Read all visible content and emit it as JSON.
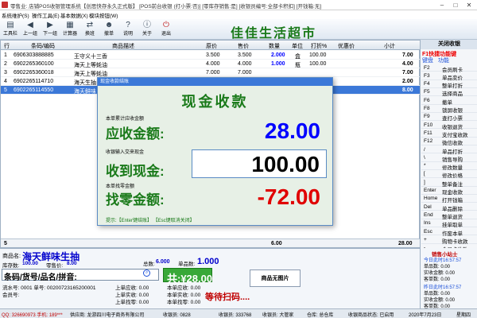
{
  "window": {
    "title": "零售业: 店铺POS收银管理系统【创思快存永久正式版】 [POS前台收银 (打小票:否)] [零库存销售:是] [收银员编号:全部卡积扣] [开钱箱:无]"
  },
  "menu": [
    "系统维护(S)",
    "操作工具(E)",
    "基本数据(X)",
    "模块按钮(W)"
  ],
  "toolbar": {
    "banner": "佳佳生活超市",
    "buttons": [
      "工具栏",
      "上一组",
      "下一组",
      "计算器",
      "换班",
      "撤单",
      "说明",
      "关于",
      "退出"
    ]
  },
  "grid": {
    "headers": [
      "行",
      "条码/编码",
      "商品描述",
      "原价",
      "售价",
      "数量",
      "单位",
      "打折%",
      "优惠价",
      "小计"
    ],
    "rows": [
      {
        "no": "1",
        "code": "6906303888885",
        "name": "王守义十三香",
        "orig": "3.500",
        "price": "3.500",
        "qty": "2.000",
        "unit": "盒",
        "disc": "100.00",
        "sub": "7.00"
      },
      {
        "no": "2",
        "code": "6902265360100",
        "name": "海天上等蚝油",
        "orig": "4.000",
        "price": "4.000",
        "qty": "1.000",
        "unit": "瓶",
        "disc": "100.00",
        "sub": "4.00"
      },
      {
        "no": "3",
        "code": "6902265360018",
        "name": "海天上等蚝油",
        "orig": "7.000",
        "price": "7.000",
        "qty": "",
        "unit": "",
        "disc": "",
        "sub": "7.00"
      },
      {
        "no": "4",
        "code": "6902265114710",
        "name": "海天生抽",
        "orig": "",
        "price": "",
        "qty": "",
        "unit": "",
        "disc": "",
        "sub": "2.00"
      },
      {
        "no": "5",
        "code": "6902265114550",
        "name": "海天鲜味",
        "orig": "",
        "price": "",
        "qty": "",
        "unit": "",
        "disc": "",
        "sub": "8.00"
      }
    ],
    "footer": {
      "count": "5",
      "qty": "6.00",
      "total": "28.00"
    }
  },
  "rpanel": {
    "title": "关闭收银",
    "hotkey": "F1快捷功能键",
    "tabs": [
      "键盘",
      "功能"
    ],
    "keys": [
      [
        "F2",
        "会员刷卡"
      ],
      [
        "F3",
        "单品变价"
      ],
      [
        "F4",
        "整单打折"
      ],
      [
        "F5",
        "选择商品"
      ],
      [
        "F6",
        "撤单"
      ],
      [
        "F8",
        "锁屏收银"
      ],
      [
        "F9",
        "查打小票"
      ],
      [
        "F10",
        "收银退货"
      ],
      [
        "F11",
        "支付宝收款"
      ],
      [
        "F12",
        "微信收款"
      ],
      [
        "/",
        "单品打折"
      ],
      [
        "\\",
        "销售导购"
      ],
      [
        "*",
        "修改数量"
      ],
      [
        "[",
        "修改价格"
      ],
      [
        "]",
        "整单备注"
      ],
      [
        "Enter",
        "现金收款"
      ],
      [
        "Home",
        "打开钱箱"
      ],
      [
        "Del",
        "单品删除"
      ],
      [
        "End",
        "整单退货"
      ],
      [
        "Ins",
        "挂单取单"
      ],
      [
        "Esc",
        "作废本单"
      ],
      [
        "+",
        "购物卡收款"
      ],
      [
        "-",
        "会员卡收款"
      ]
    ]
  },
  "dialog": {
    "title": "现金收款结账",
    "heading": "现金收款",
    "recv_small": "本单累计应收金额",
    "recv_label": "应收金额:",
    "recv_value": "28.00",
    "paid_small": "收银输入交来现金",
    "paid_label": "收到现金:",
    "paid_value": "100.00",
    "change_small": "本单找零金额",
    "change_label": "找零金额:",
    "change_value": "-72.00",
    "hint": "提示:【Enter键结账】 【Esc键取消关闭】"
  },
  "bottom": {
    "product_label": "商品名:",
    "product_name": "海天鲜味生抽",
    "stock_label": "库存数:",
    "stock_value": "100.00",
    "discount_label": "零售价:",
    "discount_value": "8.00",
    "qty_label": "总数:",
    "qty_value": "6.000",
    "price_label": "单品数:",
    "price_value": "1.000",
    "input_hint": "条码/货号/品名/拼音:",
    "flow_label": "流水号: 0001 单号: 00200723165200001",
    "member_label": "会员号:",
    "last_recv": "上单应收: 0.00",
    "last_paid": "上单实收: 0.00",
    "last_change": "上单找零: 0.00",
    "this_recv": "本单应收: 0.00",
    "this_paid": "本单实收: 0.00",
    "this_change": "本单找零: 0.00",
    "total_label": "共:¥28.00",
    "noimg": "商品无图片",
    "waiting": "等待扫码...."
  },
  "rbottom": {
    "title": "销售小站士",
    "today": "今日此时16:57:57",
    "items": [
      "单品数: 0.00",
      "实收金额: 0.00",
      "客单数: 0.00"
    ],
    "yesterday": "昨日此时16:57:57",
    "yitems": [
      "单品数: 0.00",
      "实收金额: 0.00",
      "客单数: 0.00"
    ]
  },
  "status": [
    "QQ: 326690973 手机: 189***",
    "供应商: 龙游四川电子商务有限公司",
    "收银员: 0828",
    "收银员: 333768",
    "收银员: 大管家",
    "仓库: 总仓库",
    "收银商品状态: 已启用",
    "2020年7月23日",
    "星期四"
  ],
  "colors": {
    "accent": "#3b78d8",
    "green": "#1a7a1a",
    "red": "#e00000",
    "blue": "#0000ff"
  }
}
